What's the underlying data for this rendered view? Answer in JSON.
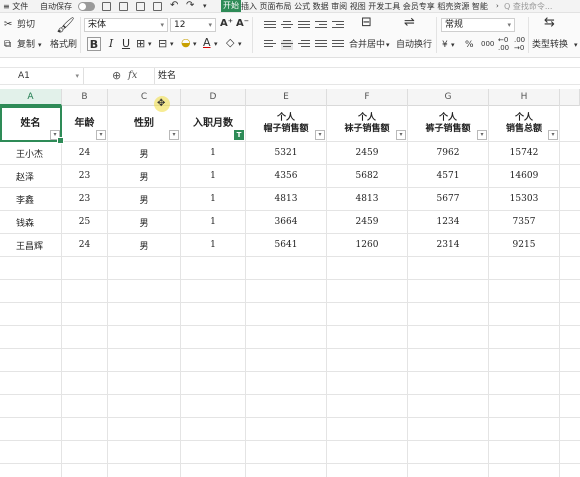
{
  "titlebar": {
    "autosave_label": "自动保存",
    "menu_active": "开始",
    "menu_items": "插入 页面布局 公式 数据 审阅 视图 开发工具 会员专享 稻壳资源 智能",
    "more_icon": "chevron-right-icon",
    "search_placeholder": "Q 查找命令..."
  },
  "ribbon": {
    "cut_label": "剪切",
    "copy_label": "复制",
    "format_painter_label": "格式刷",
    "font_name": "宋体",
    "font_size": "12",
    "bold": "B",
    "italic": "I",
    "underline": "U",
    "merge_center_label": "合并居中",
    "wrap_text_label": "自动换行",
    "number_format": "常规",
    "currency_symbol": "¥",
    "percent_symbol": "%",
    "thousands_label": "000",
    "type_convert_label": "类型转换"
  },
  "formula_bar": {
    "name_box": "A1",
    "fx_label": "fx",
    "content": "姓名"
  },
  "sheet": {
    "column_letters": [
      "A",
      "B",
      "C",
      "D",
      "E",
      "F",
      "G",
      "H"
    ],
    "headers": [
      [
        "姓名"
      ],
      [
        "年龄"
      ],
      [
        "性别"
      ],
      [
        "入职月数"
      ],
      [
        "个人",
        "帽子销售额"
      ],
      [
        "个人",
        "袜子销售额"
      ],
      [
        "个人",
        "裤子销售额"
      ],
      [
        "个人",
        "销售总额"
      ]
    ],
    "rows": [
      [
        "王小杰",
        "24",
        "男",
        "1",
        "5321",
        "2459",
        "7962",
        "15742"
      ],
      [
        "赵泽",
        "23",
        "男",
        "1",
        "4356",
        "5682",
        "4571",
        "14609"
      ],
      [
        "李鑫",
        "23",
        "男",
        "1",
        "4813",
        "4813",
        "5677",
        "15303"
      ],
      [
        "钱森",
        "25",
        "男",
        "1",
        "3664",
        "2459",
        "1234",
        "7357"
      ],
      [
        "王昌辉",
        "24",
        "男",
        "1",
        "5641",
        "1260",
        "2314",
        "9215"
      ]
    ],
    "filter_active_column": "D",
    "accent_color": "#2e8b57"
  }
}
